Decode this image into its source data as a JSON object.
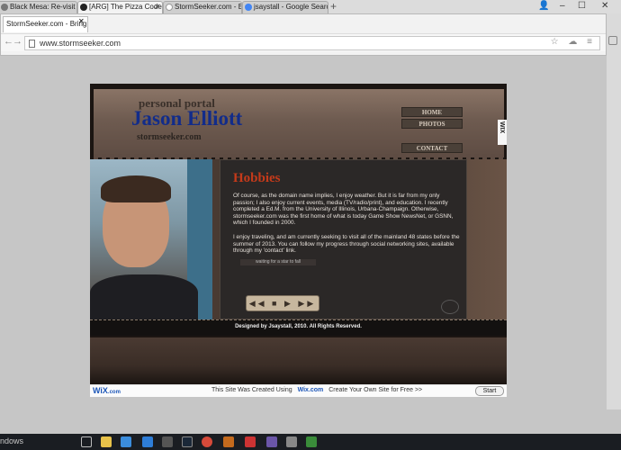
{
  "browser": {
    "tabs": [
      {
        "label": "Black Mesa: Re-visit the wor"
      },
      {
        "label": "[ARG] The Pizza Code M"
      },
      {
        "label": "StormSeeker.com - Bringin"
      },
      {
        "label": "jsaystall - Google Search"
      }
    ],
    "new_tab_label": "+",
    "window_controls": {
      "minimize": "–",
      "maximize": "☐",
      "close": "✕",
      "user": "👤"
    }
  },
  "popup": {
    "tab_label": "StormSeeker.com - Bring",
    "url": "www.stormseeker.com",
    "nav": {
      "back": "←",
      "forward": "→"
    },
    "right_icons": "☆ ☁ ≡"
  },
  "site": {
    "header": {
      "tagline": "personal portal",
      "name": "Jason Elliott",
      "domain": "stormseeker.com"
    },
    "menu": [
      "HOME",
      "PHOTOS",
      "CONTACT"
    ],
    "side_tag": "WIX",
    "hobbies": {
      "title": "Hobbies",
      "paragraph1": "Of course, as the domain name implies, I enjoy weather. But it is far from my only passion; I also enjoy current events, media (TV/radio/print), and education. I recently completed a Ed.M. from the University of Illinois, Urbana-Champaign. Otherwise, stormseeker.com was the first home of what is today Game Show NewsNet, or GSNN, which I founded in 2000.",
      "paragraph2": "I enjoy traveling, and am currently seeking to visit all of the mainland 48 states before the summer of 2013. You can follow my progress through social networking sites, available through my 'contact' link.",
      "loading_text": "waiting for a star to fall",
      "player_controls": "◀◀ ■ ▶ ▶▶"
    },
    "footer": "Designed by Jsaystall, 2010. All Rights Reserved."
  },
  "wix_bar": {
    "logo": "WiX",
    "logo_suffix": ".com",
    "prefix": "This Site Was Created Using",
    "wix_link": "Wix.com",
    "suffix": "Create Your Own Site for Free >>",
    "start_button": "Start"
  },
  "taskbar": {
    "label": "ndows"
  }
}
